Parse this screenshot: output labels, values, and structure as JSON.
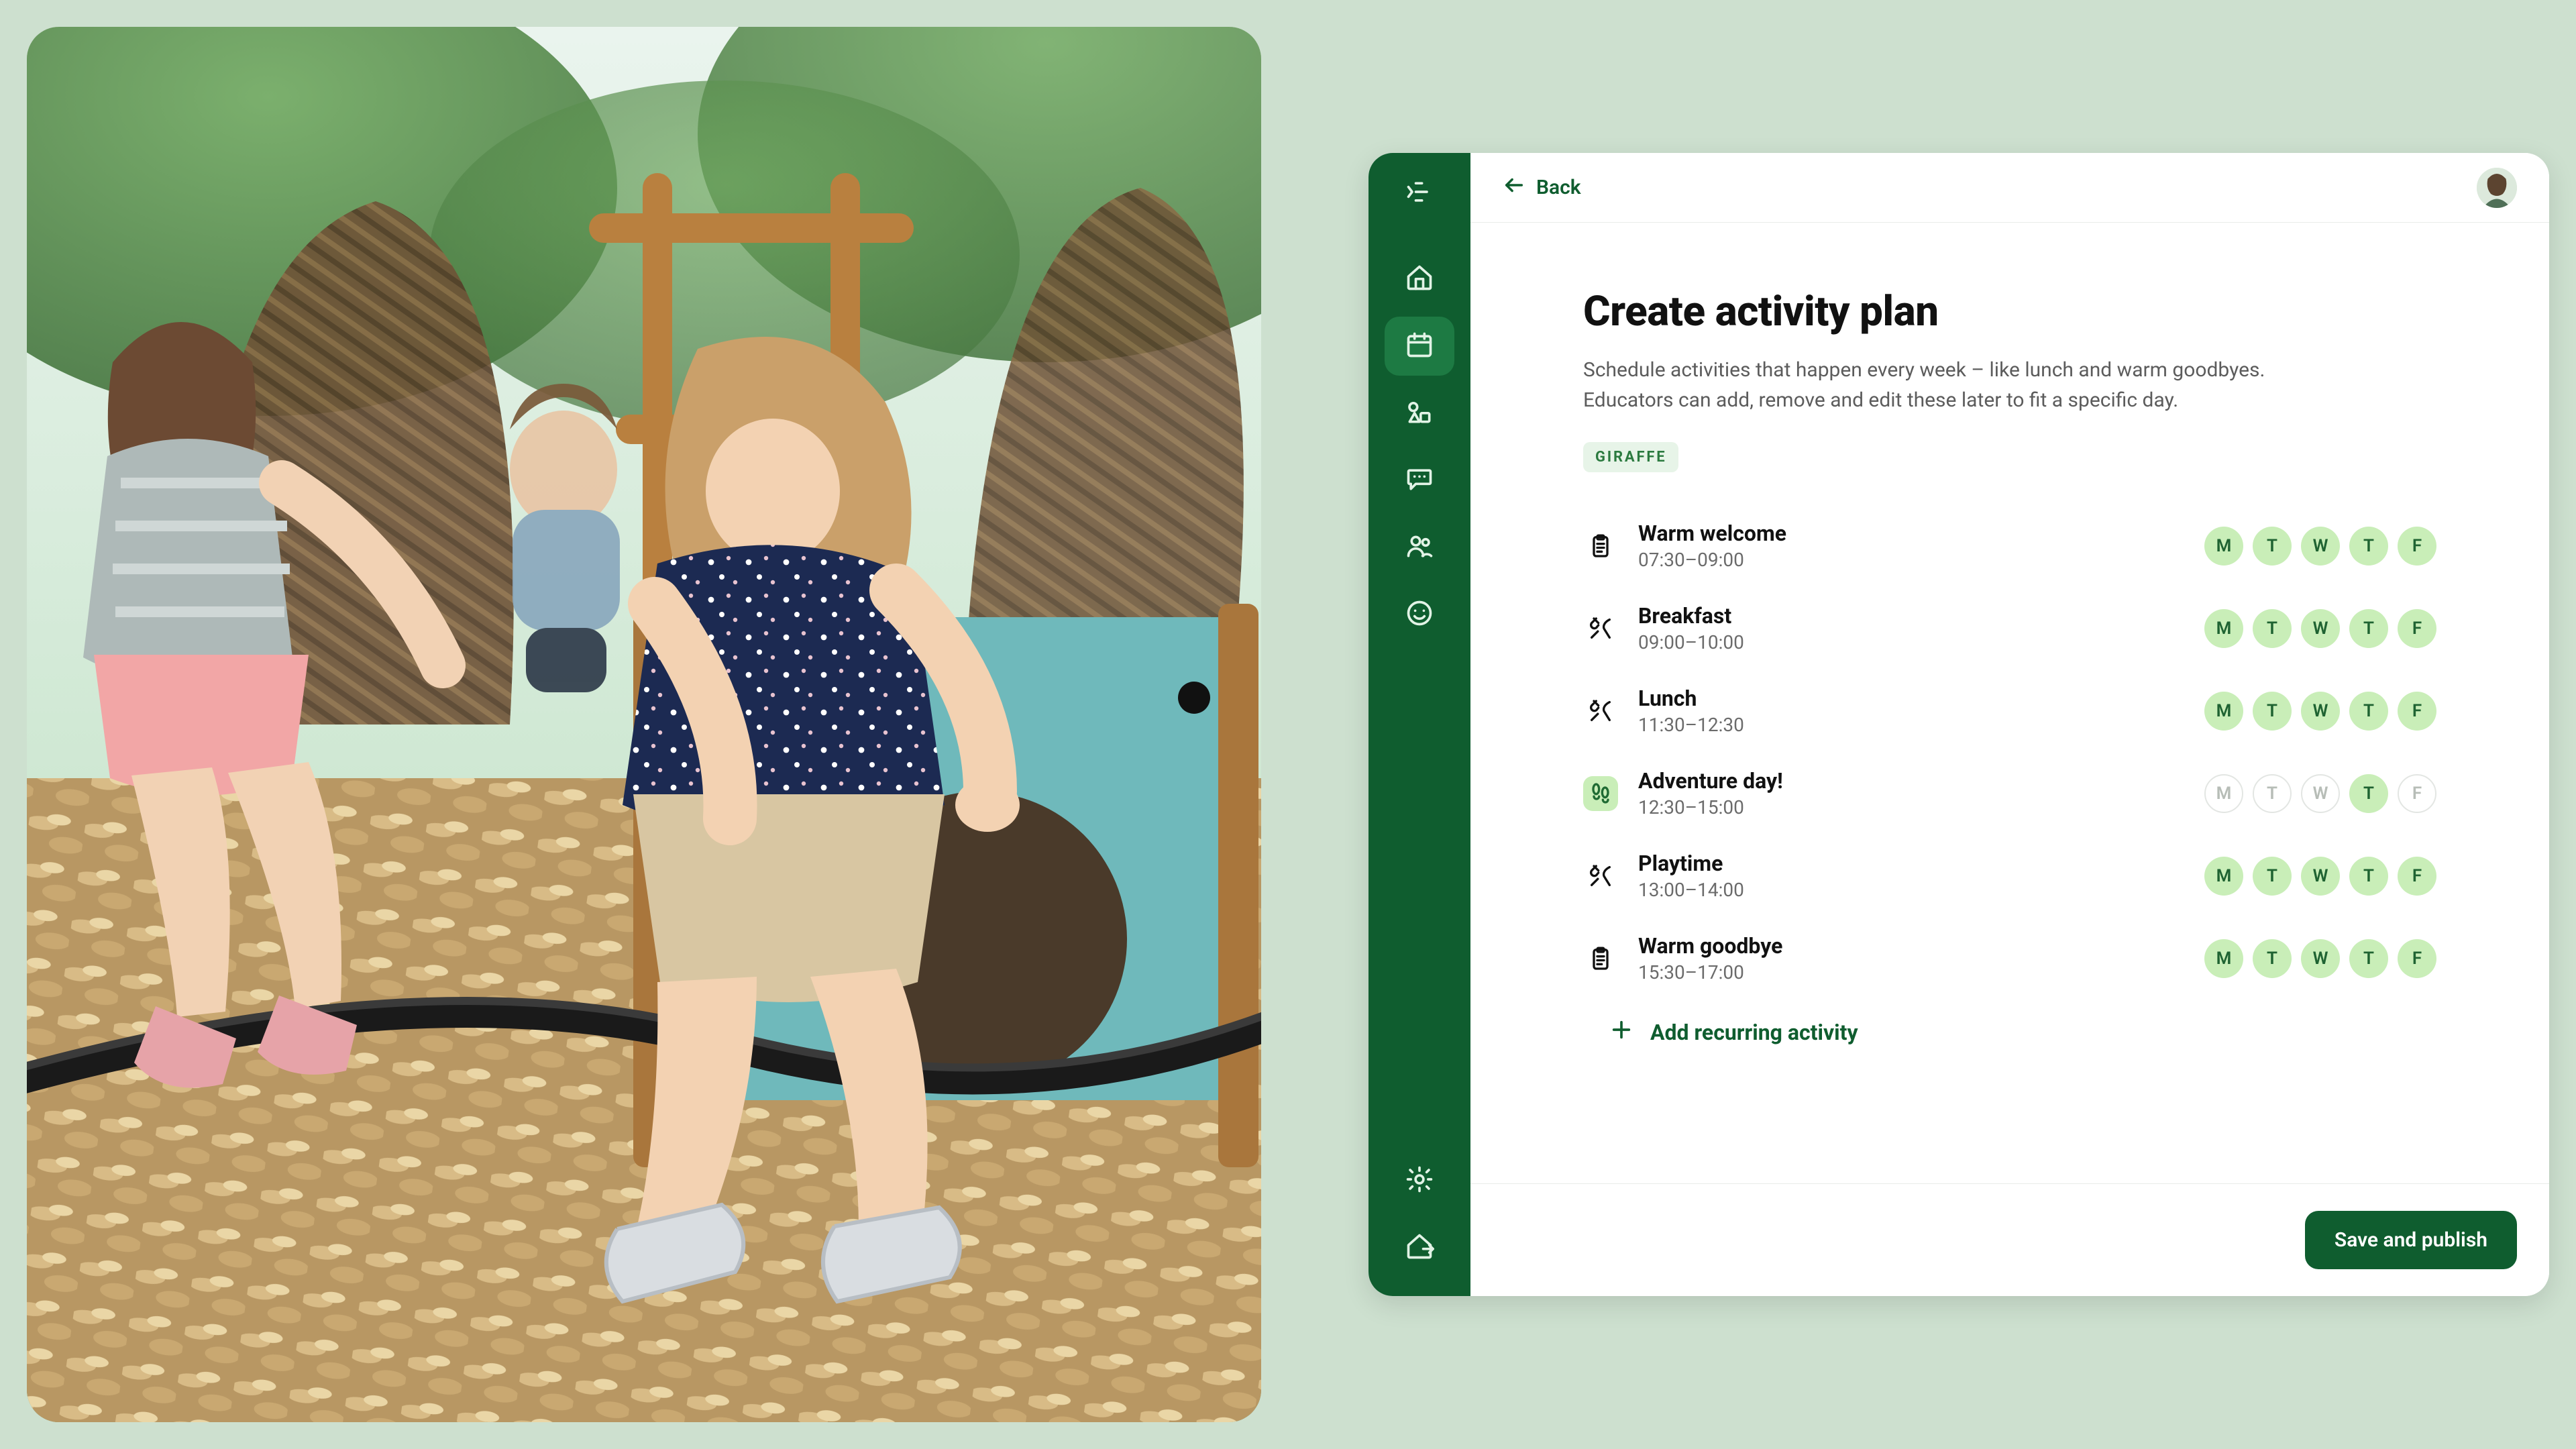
{
  "colors": {
    "brand": "#0f5d2f",
    "brandHover": "#1d7a43",
    "background": "#cde0cf",
    "pipOn": "#c9eeb8",
    "pipOnText": "#1f6332"
  },
  "topbar": {
    "back_label": "Back"
  },
  "page": {
    "title": "Create activity plan",
    "description": "Schedule activities that happen every week – like lunch and warm goodbyes. Educators can add, remove and edit these later to fit a specific day.",
    "tag": "GIRAFFE",
    "add_label": "Add recurring activity"
  },
  "days": [
    "M",
    "T",
    "W",
    "T",
    "F"
  ],
  "activities": [
    {
      "icon": "clipboard",
      "highlight": false,
      "title": "Warm welcome",
      "time": "07:30–09:00",
      "days": [
        true,
        true,
        true,
        true,
        true
      ]
    },
    {
      "icon": "utensils",
      "highlight": false,
      "title": "Breakfast",
      "time": "09:00–10:00",
      "days": [
        true,
        true,
        true,
        true,
        true
      ]
    },
    {
      "icon": "utensils",
      "highlight": false,
      "title": "Lunch",
      "time": "11:30–12:30",
      "days": [
        true,
        true,
        true,
        true,
        true
      ]
    },
    {
      "icon": "footprints",
      "highlight": true,
      "title": "Adventure day!",
      "time": "12:30–15:00",
      "days": [
        false,
        false,
        false,
        true,
        false
      ]
    },
    {
      "icon": "utensils",
      "highlight": false,
      "title": "Playtime",
      "time": "13:00–14:00",
      "days": [
        true,
        true,
        true,
        true,
        true
      ]
    },
    {
      "icon": "clipboard",
      "highlight": false,
      "title": "Warm goodbye",
      "time": "15:30–17:00",
      "days": [
        true,
        true,
        true,
        true,
        true
      ]
    }
  ],
  "footer": {
    "primary_label": "Save and publish"
  },
  "sidebar": {
    "items": [
      {
        "name": "home",
        "icon": "home",
        "active": false
      },
      {
        "name": "calendar",
        "icon": "calendar",
        "active": true
      },
      {
        "name": "shapes",
        "icon": "shapes",
        "active": false
      },
      {
        "name": "chat",
        "icon": "chat",
        "active": false
      },
      {
        "name": "people",
        "icon": "people",
        "active": false
      },
      {
        "name": "smile",
        "icon": "smile",
        "active": false
      }
    ],
    "bottom": [
      {
        "name": "settings",
        "icon": "gear"
      },
      {
        "name": "exit",
        "icon": "home-out"
      }
    ]
  }
}
